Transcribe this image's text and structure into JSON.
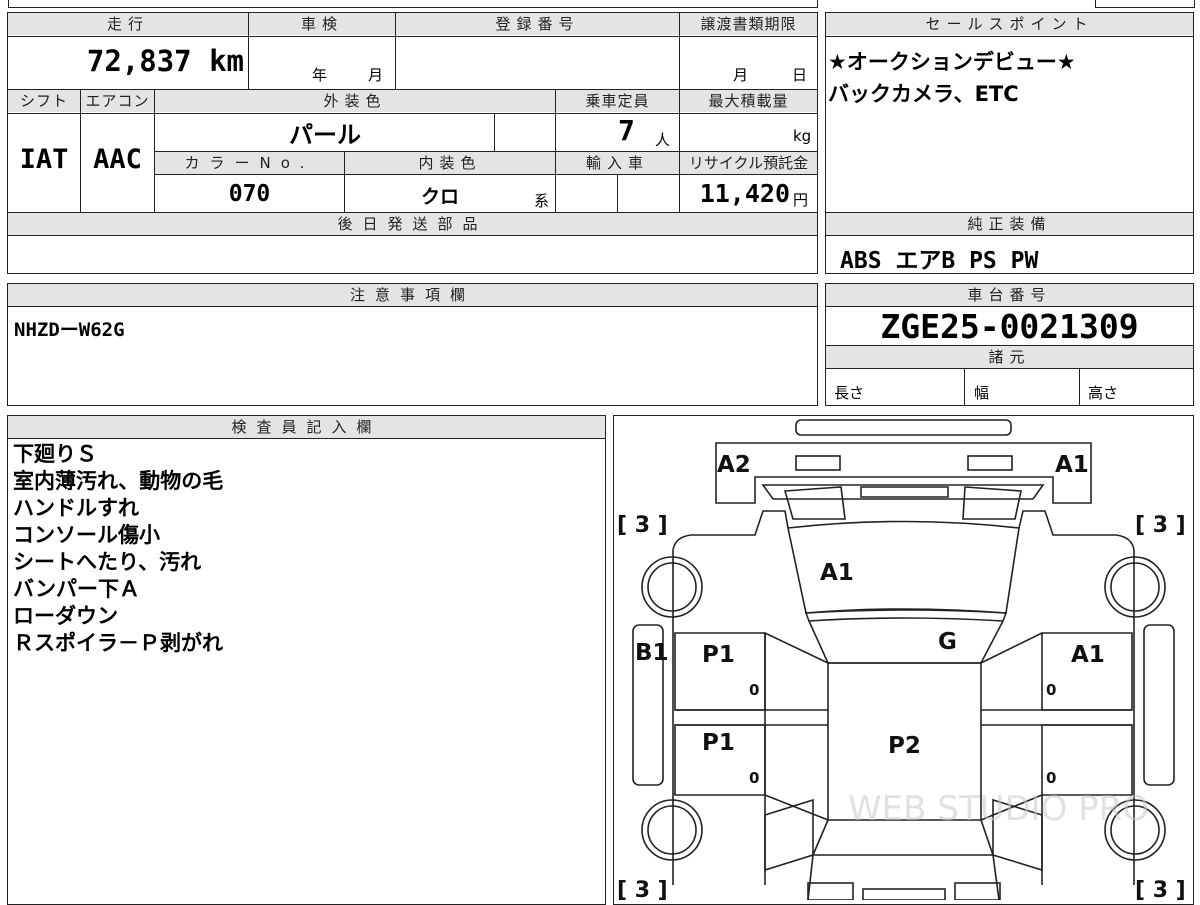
{
  "vehicle": {
    "mileage_label": "走行",
    "mileage_value": "72,837 km",
    "shaken_label": "車検",
    "shaken_year": "年",
    "shaken_month": "月",
    "reg_label": "登録番号",
    "transfer_label": "譲渡書類期限",
    "transfer_month": "月",
    "transfer_day": "日",
    "shift_label": "シフト",
    "shift_value": "IAT",
    "ac_label": "エアコン",
    "ac_value": "AAC",
    "ext_color_label": "外装色",
    "ext_color_value": "パール",
    "capacity_label": "乗車定員",
    "capacity_value": "7",
    "capacity_unit": "人",
    "max_load_label": "最大積載量",
    "max_load_unit": "kg",
    "color_no_label": "カラーNo.",
    "color_no_value": "070",
    "int_color_label": "内装色",
    "int_color_value": "クロ",
    "int_color_suffix": "系",
    "import_label": "輸入車",
    "recycle_label": "リサイクル預託金",
    "recycle_value": "11,420",
    "recycle_unit": "円",
    "later_parts_label": "後日発送部品"
  },
  "sales": {
    "label": "セールスポイント",
    "lines": [
      "★オークションデビュー★",
      "バックカメラ、ETC"
    ]
  },
  "equipment": {
    "label": "純正装備",
    "value": "ABS エアB PS PW"
  },
  "notes": {
    "label": "注意事項欄",
    "value": "NHZDーW62G"
  },
  "chassis": {
    "label": "車台番号",
    "value": "ZGE25-0021309",
    "specs_label": "諸元",
    "length_label": "長さ",
    "width_label": "幅",
    "height_label": "高さ"
  },
  "inspector": {
    "label": "検査員記入欄",
    "lines": [
      "下廻りＳ",
      "室内薄汚れ、動物の毛",
      "ハンドルすれ",
      "コンソール傷小",
      "シートへたり、汚れ",
      "バンパー下Ａ",
      "ローダウン",
      "Ｒスポイラ－Ｐ剥がれ"
    ]
  },
  "diagram": {
    "tl": "A2",
    "tr": "A1",
    "windshield": "A1",
    "left_panel": "B1",
    "front_left_door": "P1",
    "rear_left_door": "P1",
    "right_glass": "G",
    "front_right_door": "A1",
    "roof": "P2",
    "tire_tl": "[ 3 ]",
    "tire_tr": "[ 3 ]",
    "tire_bl": "[ 3 ]",
    "tire_br": "[ 3 ]",
    "zero": "0",
    "watermark": "WEB STUDIO PRO"
  }
}
